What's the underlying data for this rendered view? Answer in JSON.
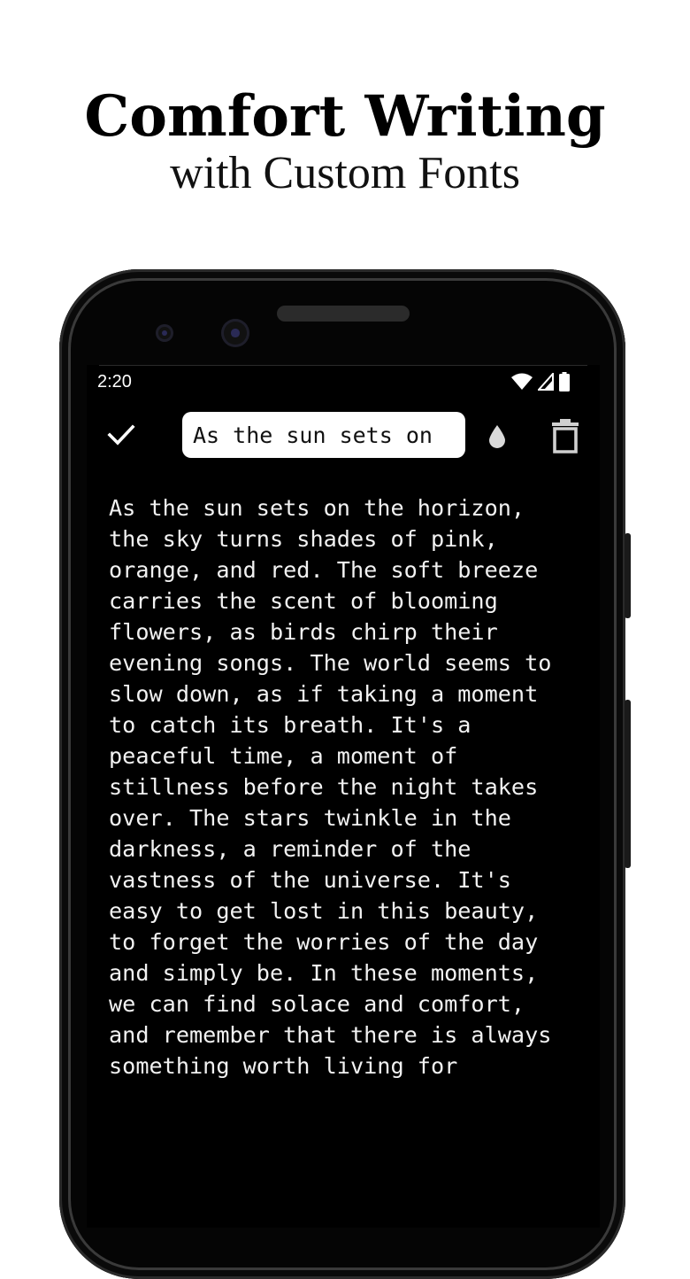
{
  "promo": {
    "headline": "Comfort Writing",
    "subheadline": "with Custom Fonts"
  },
  "status_bar": {
    "time": "2:20",
    "icons": [
      "wifi-icon",
      "cell-signal-icon",
      "battery-icon"
    ]
  },
  "toolbar": {
    "confirm_icon": "check-icon",
    "title_value": "As the sun sets on",
    "color_icon": "droplet-icon",
    "delete_icon": "trash-icon"
  },
  "note": {
    "lines": [
      "As the sun sets on the horizon,",
      "the sky turns shades of pink,",
      "orange, and red. The soft breeze",
      "carries the scent of blooming",
      "flowers, as birds chirp their",
      "evening songs. The world seems to",
      "slow down, as if taking a moment",
      "to catch its breath. It's a",
      "peaceful time, a moment of",
      "stillness before the night takes",
      "over. The stars twinkle in the",
      "darkness, a reminder of the",
      "vastness of the universe. It's",
      "easy to get lost in this beauty,",
      "to forget the worries of the day",
      "and simply be. In these moments,",
      "we can find solace and comfort,",
      "and remember that there is always",
      "something worth living for"
    ]
  },
  "colors": {
    "background": "#ffffff",
    "phone_body": "#050505",
    "screen": "#000000",
    "text": "#f2f2f2",
    "pill": "#ffffff"
  }
}
